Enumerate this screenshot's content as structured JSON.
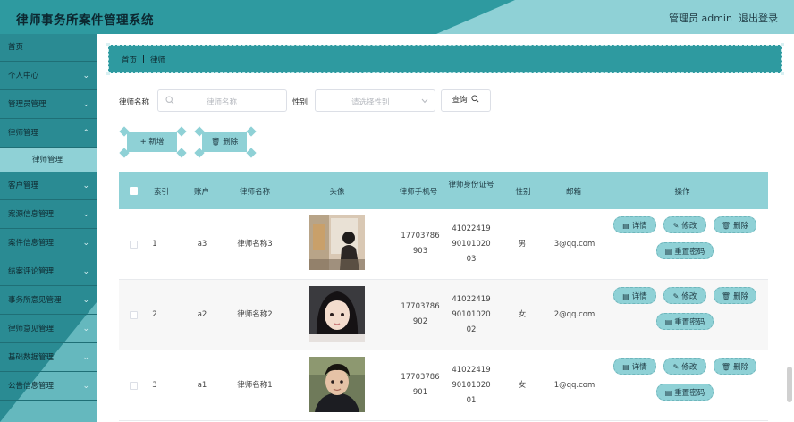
{
  "app": {
    "title": "律师事务所案件管理系统",
    "user_label": "管理员 admin",
    "logout_label": "退出登录"
  },
  "sidebar": {
    "items": [
      {
        "label": "首页",
        "has_children": false
      },
      {
        "label": "个人中心",
        "has_children": true
      },
      {
        "label": "管理员管理",
        "has_children": true
      },
      {
        "label": "律师管理",
        "has_children": true,
        "expanded": true
      },
      {
        "label": "客户管理",
        "has_children": true
      },
      {
        "label": "案源信息管理",
        "has_children": true
      },
      {
        "label": "案件信息管理",
        "has_children": true
      },
      {
        "label": "结案评论管理",
        "has_children": true
      },
      {
        "label": "事务所意见管理",
        "has_children": true
      },
      {
        "label": "律师意见管理",
        "has_children": true
      },
      {
        "label": "基础数据管理",
        "has_children": true
      },
      {
        "label": "公告信息管理",
        "has_children": true
      }
    ],
    "active_subitem": "律师管理"
  },
  "breadcrumb": [
    "首页",
    "律师"
  ],
  "search": {
    "name_label": "律师名称",
    "name_placeholder": "律师名称",
    "gender_label": "性别",
    "gender_placeholder": "请选择性别",
    "query_label": "查询"
  },
  "toolbar": {
    "add_label": "新增",
    "delete_label": "删除"
  },
  "table": {
    "columns": [
      "索引",
      "账户",
      "律师名称",
      "头像",
      "律师手机号",
      "律师身份证号",
      "性别",
      "邮箱",
      "操作"
    ],
    "rows": [
      {
        "index": "1",
        "account": "a3",
        "name": "律师名称3",
        "phone": [
          "17703786",
          "903"
        ],
        "id_card": [
          "41022419",
          "90101020",
          "03"
        ],
        "gender": "男",
        "email": "3@qq.com"
      },
      {
        "index": "2",
        "account": "a2",
        "name": "律师名称2",
        "phone": [
          "17703786",
          "902"
        ],
        "id_card": [
          "41022419",
          "90101020",
          "02"
        ],
        "gender": "女",
        "email": "2@qq.com"
      },
      {
        "index": "3",
        "account": "a1",
        "name": "律师名称1",
        "phone": [
          "17703786",
          "901"
        ],
        "id_card": [
          "41022419",
          "90101020",
          "01"
        ],
        "gender": "女",
        "email": "1@qq.com"
      }
    ],
    "ops": {
      "detail": "详情",
      "edit": "修改",
      "delete": "删除",
      "reset": "重置密码"
    }
  },
  "colors": {
    "primary": "#2e9aa0",
    "accent": "#8fd1d6",
    "text_dark": "#0f2a30"
  }
}
